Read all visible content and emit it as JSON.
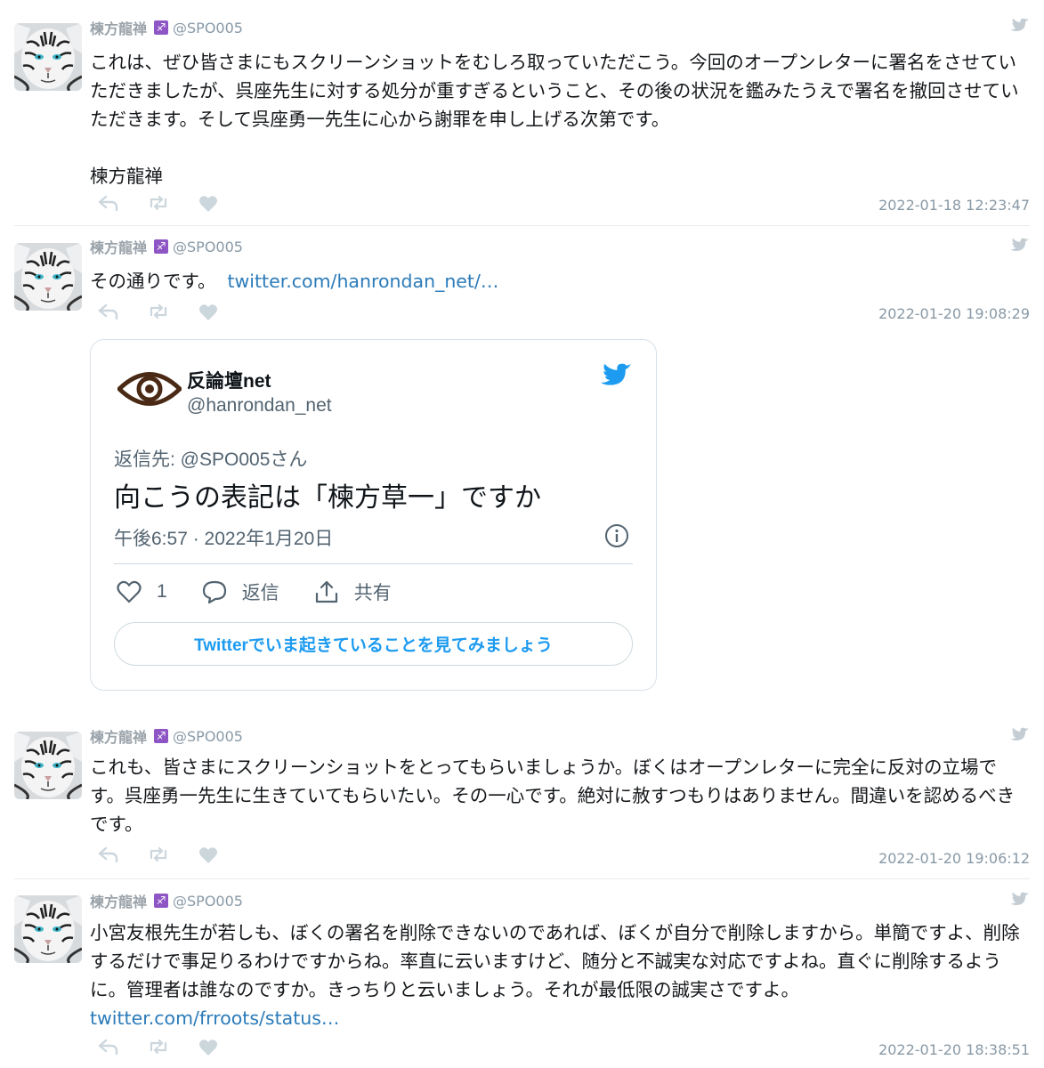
{
  "tweets": [
    {
      "name": "楝方龍禅",
      "badge": "♐",
      "handle": "@SPO005",
      "text": "これは、ぜひ皆さまにもスクリーンショットをむしろ取っていただこう。今回のオープンレターに署名をさせていただきましたが、呉座先生に対する処分が重すぎるということ、その後の状況を鑑みたうえで署名を撤回させていただきます。そして呉座勇一先生に心から謝罪を申し上げる次第です。\n\n楝方龍禅",
      "timestamp": "2022-01-18 12:23:47"
    },
    {
      "name": "楝方龍禅",
      "badge": "♐",
      "handle": "@SPO005",
      "text": "その通りです。",
      "link": "twitter.com/hanrondan_net/…",
      "timestamp": "2022-01-20 19:08:29"
    },
    {
      "name": "楝方龍禅",
      "badge": "♐",
      "handle": "@SPO005",
      "text": "これも、皆さまにスクリーンショットをとってもらいましょうか。ぼくはオープンレターに完全に反対の立場です。呉座勇一先生に生きていてもらいたい。その一心です。絶対に赦すつもりはありません。間違いを認めるべきです。",
      "timestamp": "2022-01-20 19:06:12"
    },
    {
      "name": "楝方龍禅",
      "badge": "♐",
      "handle": "@SPO005",
      "text": "小宮友根先生が若しも、ぼくの署名を削除できないのであれば、ぼくが自分で削除しますから。単簡ですよ、削除するだけで事足りるわけですからね。率直に云いますけど、随分と不誠実な対応ですよね。直ぐに削除するように。管理者は誰なのですか。きっちりと云いましょう。それが最低限の誠実さですよ。",
      "link": "twitter.com/frroots/status…",
      "timestamp": "2022-01-20 18:38:51"
    }
  ],
  "embed": {
    "name": "反論壇net",
    "handle": "@hanrondan_net",
    "reply_to": "返信先: @SPO005さん",
    "text": "向こうの表記は「楝方草一」ですか",
    "date": "午後6:57 · 2022年1月20日",
    "likes": "1",
    "reply_label": "返信",
    "share_label": "共有",
    "cta": "Twitterでいま起きていることを見てみましょう"
  },
  "colors": {
    "link": "#2b7bb9",
    "twitter_blue": "#1d9bf0",
    "muted": "#8899a6",
    "badge": "#8e55c5"
  }
}
